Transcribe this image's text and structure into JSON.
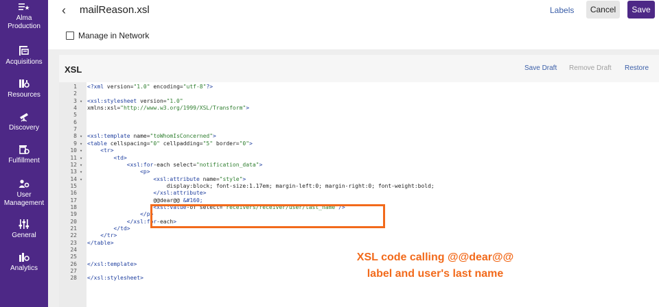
{
  "sidebar": {
    "items": [
      {
        "label_line1": "Alma",
        "label_line2": "Production",
        "icon": "list-star-icon"
      },
      {
        "label_line1": "Acquisitions",
        "label_line2": "",
        "icon": "acquisitions-icon"
      },
      {
        "label_line1": "Resources",
        "label_line2": "",
        "icon": "resources-icon"
      },
      {
        "label_line1": "Discovery",
        "label_line2": "",
        "icon": "telescope-icon"
      },
      {
        "label_line1": "Fulfillment",
        "label_line2": "",
        "icon": "fulfillment-icon"
      },
      {
        "label_line1": "User",
        "label_line2": "Management",
        "icon": "users-gear-icon"
      },
      {
        "label_line1": "General",
        "label_line2": "",
        "icon": "sliders-icon"
      },
      {
        "label_line1": "Analytics",
        "label_line2": "",
        "icon": "analytics-icon"
      }
    ]
  },
  "header": {
    "back_glyph": "‹",
    "title": "mailReason.xsl",
    "labels_link": "Labels",
    "cancel_label": "Cancel",
    "save_label": "Save"
  },
  "manage": {
    "label": "Manage in Network",
    "checked": false
  },
  "editor": {
    "title": "XSL",
    "save_draft": "Save Draft",
    "remove_draft": "Remove Draft",
    "restore": "Restore",
    "lines": [
      {
        "n": "1",
        "fold": false,
        "code": "<?xml version=\"1.0\" encoding=\"utf-8\"?>"
      },
      {
        "n": "2",
        "fold": false,
        "code": ""
      },
      {
        "n": "3",
        "fold": true,
        "code": "<xsl:stylesheet version=\"1.0\""
      },
      {
        "n": "4",
        "fold": false,
        "code": "xmlns:xsl=\"http://www.w3.org/1999/XSL/Transform\">"
      },
      {
        "n": "5",
        "fold": false,
        "code": ""
      },
      {
        "n": "6",
        "fold": false,
        "code": ""
      },
      {
        "n": "7",
        "fold": false,
        "code": ""
      },
      {
        "n": "8",
        "fold": true,
        "code": "<xsl:template name=\"toWhomIsConcerned\">"
      },
      {
        "n": "9",
        "fold": true,
        "code": "<table cellspacing=\"0\" cellpadding=\"5\" border=\"0\">"
      },
      {
        "n": "10",
        "fold": true,
        "code": "    <tr>"
      },
      {
        "n": "11",
        "fold": true,
        "code": "        <td>"
      },
      {
        "n": "12",
        "fold": true,
        "code": "            <xsl:for-each select=\"notification_data\">"
      },
      {
        "n": "13",
        "fold": true,
        "code": "                <p>"
      },
      {
        "n": "14",
        "fold": true,
        "code": "                    <xsl:attribute name=\"style\">"
      },
      {
        "n": "15",
        "fold": false,
        "code": "                        display:block; font-size:1.17em; margin-left:0; margin-right:0; font-weight:bold;"
      },
      {
        "n": "16",
        "fold": false,
        "code": "                    </xsl:attribute>"
      },
      {
        "n": "17",
        "fold": false,
        "code": "                    @@dear@@ &#160;"
      },
      {
        "n": "18",
        "fold": false,
        "code": "                    <xsl:value-of select=\"receivers/receiver/user/last_name\"/>"
      },
      {
        "n": "19",
        "fold": false,
        "code": "                </p>"
      },
      {
        "n": "20",
        "fold": false,
        "code": "            </xsl:for-each>"
      },
      {
        "n": "21",
        "fold": false,
        "code": "        </td>"
      },
      {
        "n": "22",
        "fold": false,
        "code": "    </tr>"
      },
      {
        "n": "23",
        "fold": false,
        "code": "</table>"
      },
      {
        "n": "24",
        "fold": false,
        "code": ""
      },
      {
        "n": "25",
        "fold": false,
        "code": ""
      },
      {
        "n": "26",
        "fold": false,
        "code": "</xsl:template>"
      },
      {
        "n": "27",
        "fold": false,
        "code": ""
      },
      {
        "n": "28",
        "fold": false,
        "code": "</xsl:stylesheet>"
      }
    ]
  },
  "annotation": {
    "line1": "XSL code calling @@dear@@",
    "line2": "label and user's last name",
    "color": "#f26a1b"
  },
  "colors": {
    "brand": "#4d2886",
    "link": "#3a5ea8"
  }
}
